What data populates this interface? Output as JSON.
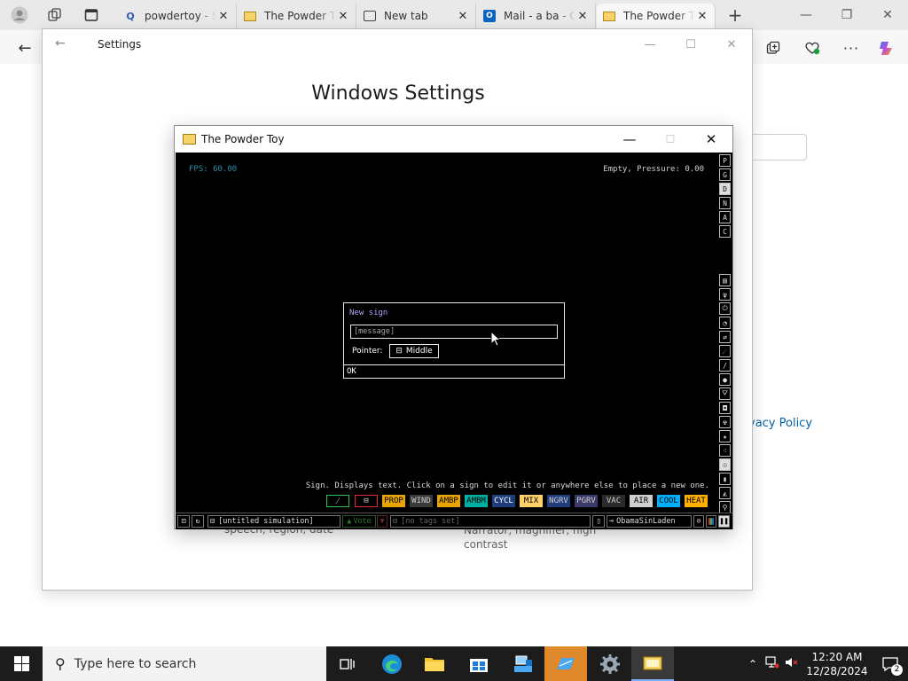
{
  "browser": {
    "tabs": [
      {
        "title": "powdertoy - S",
        "icon": "search-icon"
      },
      {
        "title": "The Powder To",
        "icon": "powder-toy-icon"
      },
      {
        "title": "New tab",
        "icon": "new-tab-icon"
      },
      {
        "title": "Mail - a ba - O",
        "icon": "outlook-icon"
      },
      {
        "title": "The Powder To",
        "icon": "powder-toy-icon"
      }
    ],
    "mail_icon_letter": "O",
    "behind_link": "vacy Policy"
  },
  "settings": {
    "title": "Settings",
    "heading": "Windows Settings",
    "sub1": "speech, region, date",
    "sub2": "Narrator, magnifier, high contrast"
  },
  "ptoy": {
    "title": "The Powder Toy",
    "fps": "FPS: 60.00",
    "pressure": "Empty, Pressure: 0.00",
    "right_top_buttons": [
      "P",
      "G",
      "D",
      "N",
      "A",
      "C"
    ],
    "hint": "Sign. Displays text. Click on a sign to edit it or anywhere else to place a new one.",
    "elements": [
      {
        "label": "PROP",
        "color": "#e8a400"
      },
      {
        "label": "WIND",
        "color": "#3a3a3a",
        "text": "#cfcfcf"
      },
      {
        "label": "AMBP",
        "color": "#e8a400"
      },
      {
        "label": "AMBM",
        "color": "#00b0a0"
      },
      {
        "label": "CYCL",
        "color": "#1f3d7a",
        "text": "#ffffff"
      },
      {
        "label": "MIX",
        "color": "#ffd06a"
      },
      {
        "label": "NGRV",
        "color": "#1f3d7a",
        "text": "#cfcfcf"
      },
      {
        "label": "PGRV",
        "color": "#3a3a6a",
        "text": "#cfcfcf"
      },
      {
        "label": "VAC",
        "color": "#2b2b2b",
        "text": "#cfcfcf"
      },
      {
        "label": "AIR",
        "color": "#cfcfcf"
      },
      {
        "label": "COOL",
        "color": "#00b0ff"
      },
      {
        "label": "HEAT",
        "color": "#ffb000"
      }
    ],
    "bottom": {
      "sim_name": "[untitled simulation]",
      "vote": "Vote",
      "tags": "[no tags set]",
      "user": "ObamaSinLaden"
    },
    "sign_dialog": {
      "title": "New sign",
      "placeholder": "[message]",
      "pointer_label": "Pointer:",
      "pointer_value": "Middle",
      "ok": "OK"
    }
  },
  "taskbar": {
    "search_placeholder": "Type here to search",
    "time": "12:20 AM",
    "date": "12/28/2024",
    "notification_count": "2"
  }
}
